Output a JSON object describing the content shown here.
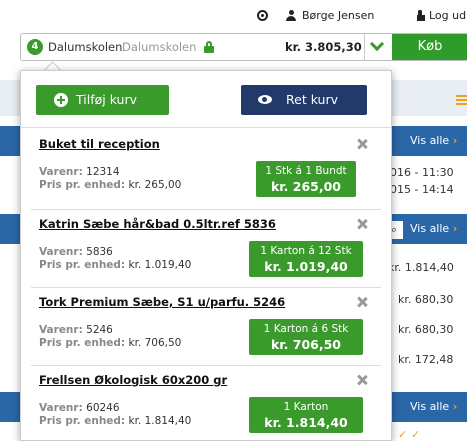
{
  "topbar": {
    "help_icon": "help-circle-icon",
    "user_icon": "user-icon",
    "user_name": "Børge Jensen",
    "logout_icon": "unlock-icon",
    "logout_label": "Log ud"
  },
  "header": {
    "badge_count": "4",
    "store_name": "Dalumskolen",
    "store_sub": "Dalumskolen",
    "lock_icon": "lock-icon",
    "total": "kr. 3.805,30",
    "chevron_icon": "chevron-down-icon",
    "buy_label": "Køb",
    "accent_color": "#3a9a2b"
  },
  "background": {
    "vis_alle_1": "Vis alle",
    "vis_alle_2": "Vis alle",
    "vis_alle_3": "Vis alle",
    "date_1": "016 - 11:30",
    "date_2": "015 - 14:14",
    "price_1": "kr. 1.814,40",
    "price_2": "kr. 680,30",
    "price_3": "kr. 680,30",
    "price_4": "kr. 172,48",
    "search_icon": "search-icon"
  },
  "panel": {
    "add_label": "Tilføj kurv",
    "edit_label": "Ret kurv",
    "add_button_color": "#3a9a2b",
    "edit_button_color": "#213a6a",
    "varenr_label": "Varenr:",
    "pris_label": "Pris pr. enhed:",
    "items": [
      {
        "title": "Buket til reception",
        "varenr": "12314",
        "pris": "kr. 265,00",
        "qty": "1  Stk  á 1 Bundt",
        "total": "kr. 265,00"
      },
      {
        "title": "Katrin Sæbe hår&bad 0.5ltr.ref 5836",
        "varenr": "5836",
        "pris": "kr. 1.019,40",
        "qty": "1  Karton  á 12 Stk",
        "total": "kr. 1.019,40"
      },
      {
        "title": "Tork Premium Sæbe, S1 u/parfu. 5246",
        "varenr": "5246",
        "pris": "kr. 706,50",
        "qty": "1  Karton  á 6 Stk",
        "total": "kr. 706,50"
      },
      {
        "title": "Frellsen Økologisk 60x200 gr",
        "varenr": "60246",
        "pris": "kr. 1.814,40",
        "qty": "1  Karton",
        "total": "kr. 1.814,40"
      }
    ]
  }
}
